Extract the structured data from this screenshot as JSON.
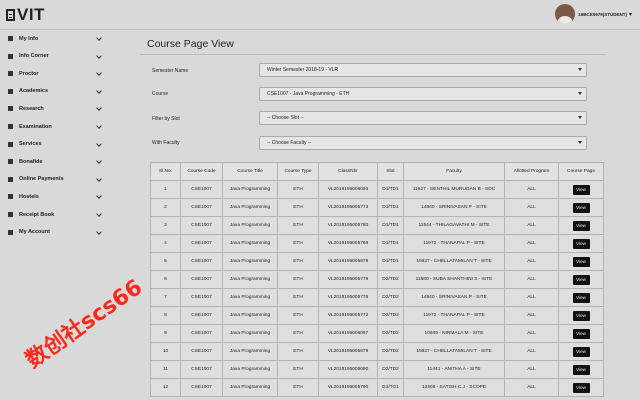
{
  "header": {
    "logo_text": "VIT",
    "user_name": "16BCE0979(STUDENT)"
  },
  "sidebar": {
    "items": [
      {
        "label": "My Info",
        "icon": "user-icon"
      },
      {
        "label": "Info Corner",
        "icon": "info-icon"
      },
      {
        "label": "Proctor",
        "icon": "proctor-icon"
      },
      {
        "label": "Academics",
        "icon": "graduation-cap-icon"
      },
      {
        "label": "Research",
        "icon": "bank-icon"
      },
      {
        "label": "Examination",
        "icon": "exam-icon"
      },
      {
        "label": "Services",
        "icon": "services-icon"
      },
      {
        "label": "Bonafide",
        "icon": "certificate-icon"
      },
      {
        "label": "Online Payments",
        "icon": "credit-card-icon"
      },
      {
        "label": "Hostels",
        "icon": "building-icon"
      },
      {
        "label": "Receipt Book",
        "icon": "rupee-icon"
      },
      {
        "label": "My Account",
        "icon": "account-icon"
      }
    ]
  },
  "main": {
    "title": "Course Page View",
    "form": {
      "semester_label": "Semester Name",
      "semester_value": "Winter Semester 2018-19 - VLR",
      "course_label": "Course",
      "course_value": "CSE1007 - Java Programming - ETH",
      "slot_label": "Filter by Slot",
      "slot_value": "-- Choose Slot --",
      "faculty_label": "With Faculty",
      "faculty_value": "-- Choose Faculty --"
    },
    "table": {
      "headers": [
        "Sl.No.",
        "Course Code",
        "Course Title",
        "Course Type",
        "ClassNbr",
        "Slot",
        "Faculty",
        "Allotted Program",
        "Course Page"
      ],
      "view_label": "View",
      "rows": [
        [
          "1",
          "CSE1007",
          "Java Programming",
          "ETH",
          "VL2018195006093",
          "D1/TD1",
          "11627 - SENTHIL MURUGAN B - SDC",
          "ALL"
        ],
        [
          "2",
          "CSE1007",
          "Java Programming",
          "ETH",
          "VL2018195005773",
          "D1/TD1",
          "14840 - SRINIVASAN P - SITE",
          "ALL"
        ],
        [
          "3",
          "CSE1007",
          "Java Programming",
          "ETH",
          "VL2018195005780",
          "D1/TD1",
          "11544 - THILAGAVATHI M - SITE",
          "ALL"
        ],
        [
          "4",
          "CSE1007",
          "Java Programming",
          "ETH",
          "VL2018195005769",
          "D1/TD1",
          "11972 - THANAPAL P - SITE",
          "ALL"
        ],
        [
          "5",
          "CSE1007",
          "Java Programming",
          "ETH",
          "VL2018195005876",
          "D1/TD1",
          "15927 - CHELLATAMILAN T - SITE",
          "ALL"
        ],
        [
          "6",
          "CSE1007",
          "Java Programming",
          "ETH",
          "VL2018195005779",
          "D2/TD2",
          "11580 - SUBA SHANTHINI S - SITE",
          "ALL"
        ],
        [
          "7",
          "CSE1007",
          "Java Programming",
          "ETH",
          "VL2018195005776",
          "D2/TD2",
          "14840 - SRINIVASAN P - SITE",
          "ALL"
        ],
        [
          "8",
          "CSE1007",
          "Java Programming",
          "ETH",
          "VL2018195005772",
          "D2/TD2",
          "11972 - THANAPAL P - SITE",
          "ALL"
        ],
        [
          "9",
          "CSE1007",
          "Java Programming",
          "ETH",
          "VL2018195006087",
          "D2/TD2",
          "10949 - NIRMALA M - SITE",
          "ALL"
        ],
        [
          "10",
          "CSE1007",
          "Java Programming",
          "ETH",
          "VL2018195005879",
          "D2/TD2",
          "15927 - CHELLATAMILAN T - SITE",
          "ALL"
        ],
        [
          "11",
          "CSE1007",
          "Java Programming",
          "ETH",
          "VL2018195006090",
          "D2/TD2",
          "11441 - ANITHA A - SITE",
          "ALL"
        ],
        [
          "12",
          "CSE1007",
          "Java Programming",
          "ETH",
          "VL2018195005790",
          "G1/TG1",
          "12308 - SATISH C.J - SCOPE",
          "ALL"
        ]
      ]
    }
  },
  "watermark": "数创社scs66"
}
